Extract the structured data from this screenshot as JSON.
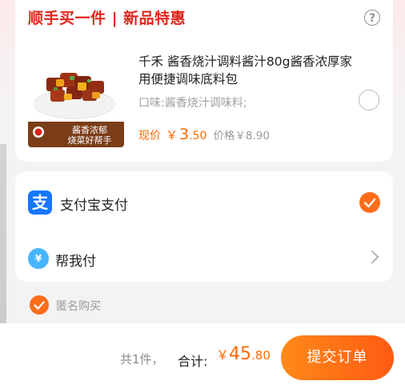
{
  "deal": {
    "title": "顺手买一件 | 新品特惠",
    "help_icon": "question-circle-icon",
    "product": {
      "name": "千禾 酱香烧汁调料酱汁80g酱香浓厚家用便捷调味底料包",
      "flavor": "口味:酱香烧汁调味料;",
      "image_caption_line1": "酱香浓郁",
      "image_caption_line2": "烧菜好帮手",
      "now_label": "现价",
      "currency": "￥",
      "now_int": "3",
      "now_dec": ".50",
      "orig_price": "价格￥8.90"
    }
  },
  "payment": {
    "alipay": {
      "icon_glyph": "支",
      "label": "支付宝支付",
      "selected": true
    },
    "helpme": {
      "icon_glyph": "¥",
      "label": "帮我付"
    }
  },
  "anonymous": {
    "label": "匿名购买",
    "checked": true
  },
  "footer": {
    "count_text": "共1件，",
    "total_label": "合计:",
    "currency": "￥",
    "total_int": "45",
    "total_dec": ".80",
    "submit_label": "提交订单"
  },
  "colors": {
    "brand_red": "#e1251b",
    "accent_orange": "#ff6a00",
    "alipay_blue": "#1677ff"
  }
}
